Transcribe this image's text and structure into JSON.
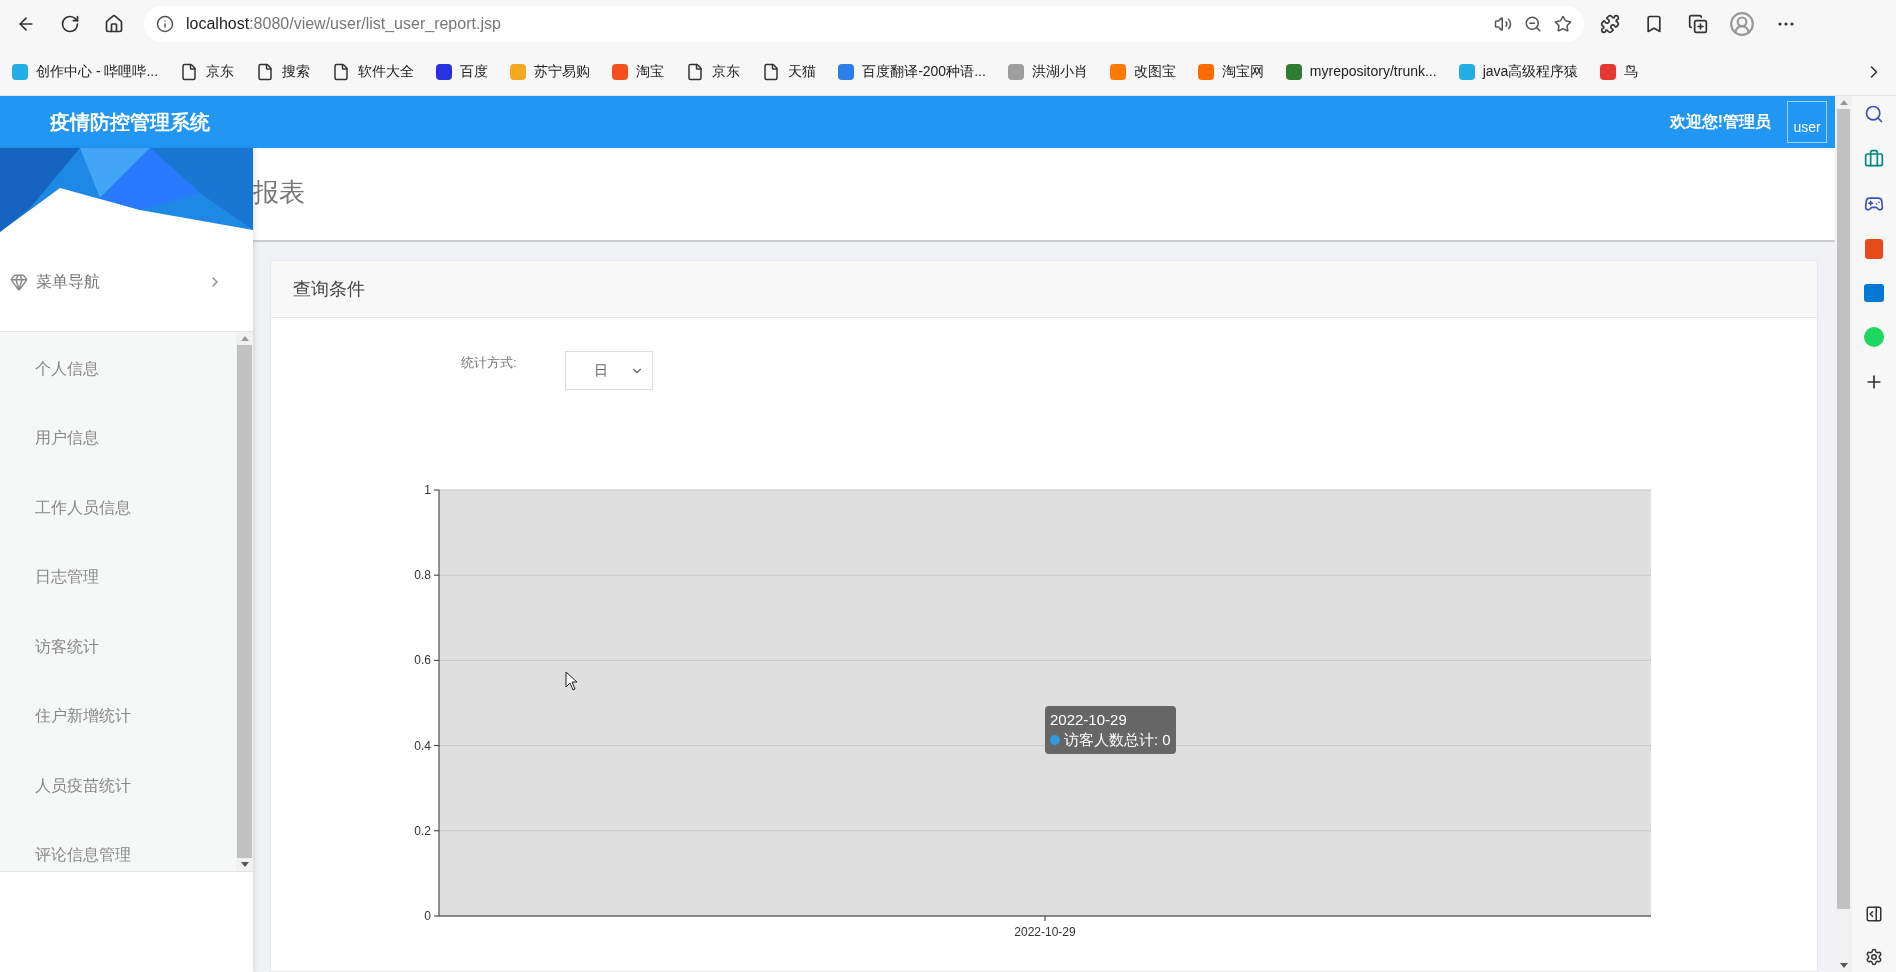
{
  "browser": {
    "url_host": "localhost",
    "url_path": ":8080/view/user/list_user_report.jsp"
  },
  "bookmarks": [
    {
      "label": "创作中心 - 哔哩哔...",
      "kind": "logo",
      "color": "#23ade5"
    },
    {
      "label": "京东",
      "kind": "file"
    },
    {
      "label": "搜索",
      "kind": "file"
    },
    {
      "label": "软件大全",
      "kind": "file"
    },
    {
      "label": "百度",
      "kind": "logo",
      "color": "#2932e1"
    },
    {
      "label": "苏宁易购",
      "kind": "logo",
      "color": "#f5a623"
    },
    {
      "label": "淘宝",
      "kind": "logo",
      "color": "#f4511e"
    },
    {
      "label": "京东",
      "kind": "file"
    },
    {
      "label": "天猫",
      "kind": "file"
    },
    {
      "label": "百度翻译-200种语...",
      "kind": "logo",
      "color": "#2b7de9"
    },
    {
      "label": "洪湖小肖",
      "kind": "logo",
      "color": "#9e9e9e"
    },
    {
      "label": "改图宝",
      "kind": "logo",
      "color": "#ff7a00"
    },
    {
      "label": "淘宝网",
      "kind": "logo",
      "color": "#ff6a00"
    },
    {
      "label": "myrepository/trunk...",
      "kind": "logo",
      "color": "#2e7d32"
    },
    {
      "label": "java高级程序猿",
      "kind": "logo",
      "color": "#23ade5"
    },
    {
      "label": "鸟",
      "kind": "logo",
      "color": "#e53935"
    }
  ],
  "app": {
    "title": "疫情防控管理系统",
    "welcome": "欢迎您!管理员",
    "avatar_alt": "user"
  },
  "sidebar": {
    "heading": "菜单导航",
    "items": [
      "个人信息",
      "用户信息",
      "工作人员信息",
      "日志管理",
      "访客统计",
      "住户新增统计",
      "人员疫苗统计",
      "评论信息管理"
    ]
  },
  "page_title": "报表",
  "query": {
    "title": "查询条件",
    "filter_label": "统计方式:",
    "select_value": "日"
  },
  "chart_data": {
    "type": "bar",
    "categories": [
      "2022-10-29"
    ],
    "series": [
      {
        "name": "访客人数总计",
        "color": "#2f9be0",
        "values": [
          0
        ]
      }
    ],
    "ylim": [
      0,
      1
    ],
    "yticks": [
      0,
      0.2,
      0.4,
      0.6,
      0.8,
      1
    ],
    "grid": true
  },
  "tooltip": {
    "title": "2022-10-29",
    "separator": ":",
    "value": "0"
  }
}
